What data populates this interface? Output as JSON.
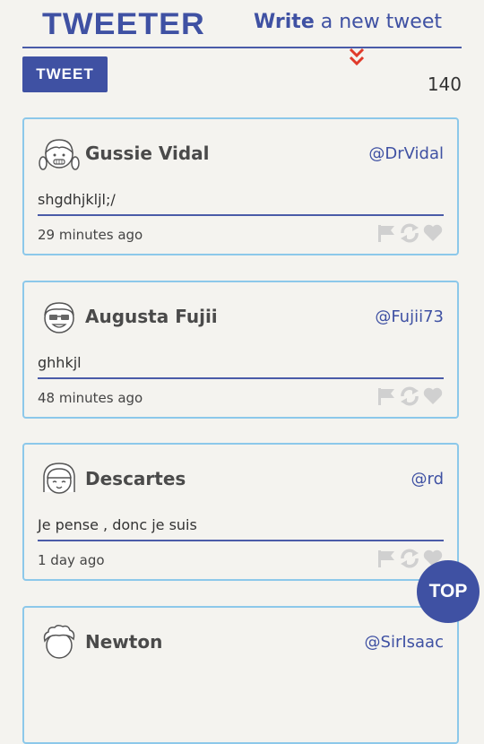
{
  "header": {
    "logo": "TWEETER",
    "write_bold": "Write",
    "write_rest": " a new tweet"
  },
  "composer": {
    "tweet_button": "TWEET",
    "char_count": "140"
  },
  "tweets": [
    {
      "name": "Gussie Vidal",
      "handle": "@DrVidal",
      "text": "shgdhjkljl;/",
      "time": "29 minutes ago",
      "avatar": "girl-pigtails-avatar"
    },
    {
      "name": "Augusta Fujii",
      "handle": "@Fujii73",
      "text": "ghhkjl",
      "time": "48 minutes ago",
      "avatar": "glasses-avatar"
    },
    {
      "name": "Descartes",
      "handle": "@rd",
      "text": "Je pense , donc je suis",
      "time": "1 day ago",
      "avatar": "bob-hair-avatar"
    },
    {
      "name": "Newton",
      "handle": "@SirIsaac",
      "text": "",
      "time": "",
      "avatar": "curly-hair-avatar"
    }
  ],
  "actions": [
    "flag-icon",
    "retweet-icon",
    "heart-icon"
  ],
  "top_button": "TOP",
  "colors": {
    "primary": "#3f51a3",
    "card_border": "#8cc8ea",
    "background": "#f4f3ef",
    "icon_gray": "#d0d0d0",
    "chevron": "#e03a2a"
  }
}
